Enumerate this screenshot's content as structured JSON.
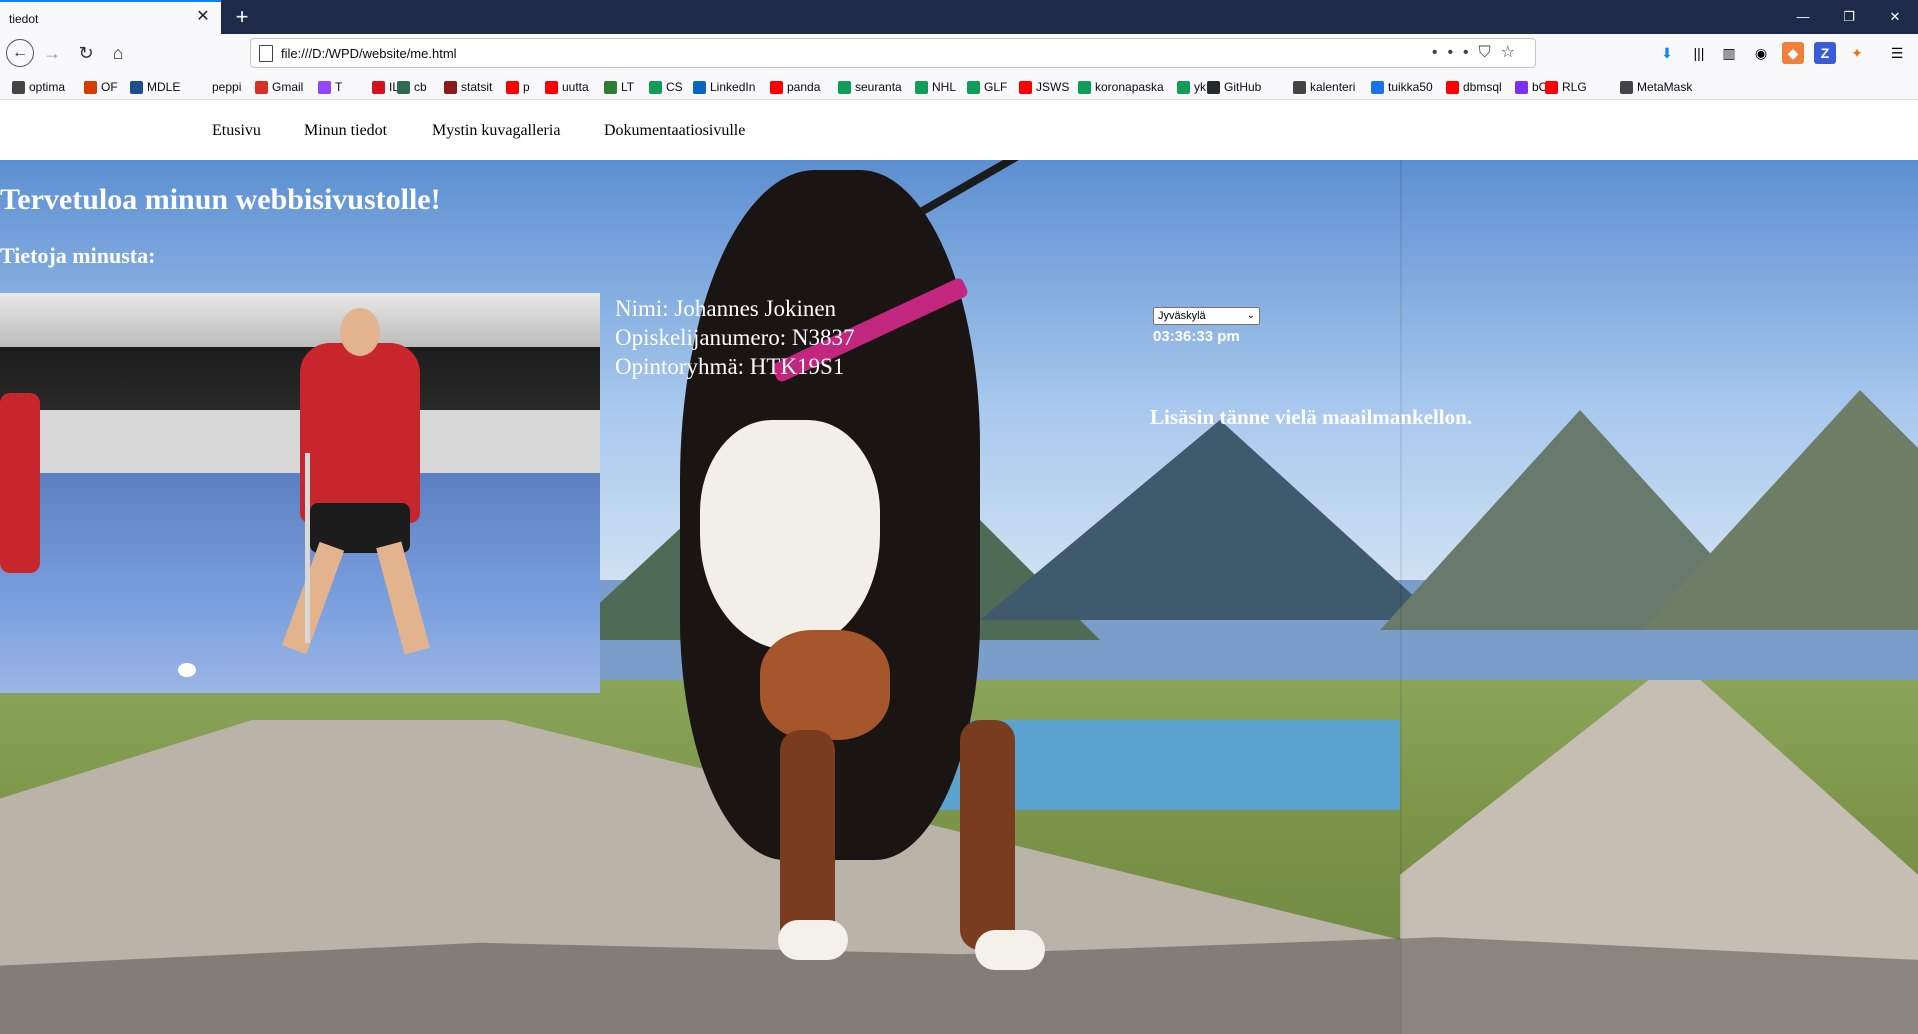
{
  "browser": {
    "tab_title": "tiedot",
    "url": "file:///D:/WPD/website/me.html",
    "bookmarks": [
      {
        "label": "optima",
        "icon": "globe-icon",
        "color": "#444444"
      },
      {
        "label": "OF",
        "icon": "office-icon",
        "color": "#d83b01"
      },
      {
        "label": "MDLE",
        "icon": "moodle-icon",
        "color": "#1f4e8c"
      },
      {
        "label": "peppi",
        "icon": "",
        "color": ""
      },
      {
        "label": "Gmail",
        "icon": "gmail-icon",
        "color": "#d93025"
      },
      {
        "label": "T",
        "icon": "twitch-icon",
        "color": "#9146ff"
      },
      {
        "label": "IL",
        "icon": "il-icon",
        "color": "#d5121c"
      },
      {
        "label": "cb",
        "icon": "cb-icon",
        "color": "#2d6a4f"
      },
      {
        "label": "statsit",
        "icon": "n-icon",
        "color": "#8b1a1a"
      },
      {
        "label": "p",
        "icon": "youtube-icon",
        "color": "#ff0000"
      },
      {
        "label": "uutta",
        "icon": "youtube-icon",
        "color": "#ff0000"
      },
      {
        "label": "LT",
        "icon": "lt-icon",
        "color": "#2e7d32"
      },
      {
        "label": "CS",
        "icon": "sheets-icon",
        "color": "#0f9d58"
      },
      {
        "label": "LinkedIn",
        "icon": "linkedin-icon",
        "color": "#0a66c2"
      },
      {
        "label": "panda",
        "icon": "youtube-icon",
        "color": "#ff0000"
      },
      {
        "label": "seuranta",
        "icon": "sheets-icon",
        "color": "#0f9d58"
      },
      {
        "label": "NHL",
        "icon": "sheets-icon",
        "color": "#0f9d58"
      },
      {
        "label": "GLF",
        "icon": "sheets-icon",
        "color": "#0f9d58"
      },
      {
        "label": "JSWS",
        "icon": "youtube-icon",
        "color": "#ff0000"
      },
      {
        "label": "koronapaska",
        "icon": "sheets-icon",
        "color": "#0f9d58"
      },
      {
        "label": "yk",
        "icon": "sheets-icon",
        "color": "#0f9d58"
      },
      {
        "label": "GitHub",
        "icon": "github-icon",
        "color": "#24292e"
      },
      {
        "label": "kalenteri",
        "icon": "globe-icon",
        "color": "#444444"
      },
      {
        "label": "tuikka50",
        "icon": "calendar-icon",
        "color": "#1a73e8"
      },
      {
        "label": "dbmsql",
        "icon": "youtube-icon",
        "color": "#ff0000"
      },
      {
        "label": "bO",
        "icon": "b-icon",
        "color": "#7b2ff7"
      },
      {
        "label": "RLG",
        "icon": "youtube-icon",
        "color": "#ff0000"
      },
      {
        "label": "MetaMask",
        "icon": "globe-icon",
        "color": "#444444"
      }
    ]
  },
  "site": {
    "menu": [
      "Etusivu",
      "Minun tiedot",
      "Mystin kuvagalleria",
      "Dokumentaatiosivulle"
    ],
    "welcome": "Tervetuloa minun webbisivustolle!",
    "about_heading": "Tietoja minusta:",
    "info": {
      "name": "Nimi: Johannes Jokinen",
      "student_no": "Opiskelijanumero: N3837",
      "group": "Opintoryhmä: HTK19S1"
    },
    "timezone": {
      "selected": "Jyväskylä"
    },
    "clock": "03:36:33 pm",
    "note": "Lisäsin tänne vielä maailmankellon."
  }
}
